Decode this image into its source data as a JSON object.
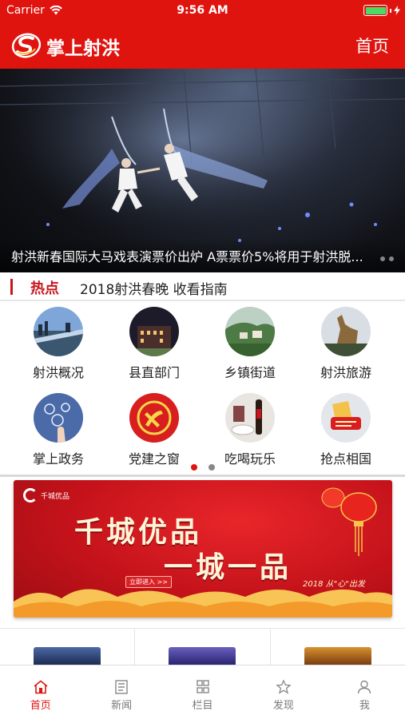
{
  "status_bar": {
    "carrier": "Carrier",
    "time": "9:56 AM",
    "battery_level": 1.0
  },
  "header": {
    "title": "掌上射洪",
    "home_link": "首页"
  },
  "banner": {
    "caption": "射洪新春国际大马戏表演票价出炉   A票票价5%将用于射洪脱...",
    "slide_count": 2
  },
  "hot": {
    "label": "热点",
    "headline": "2018射洪春晚  收看指南"
  },
  "grid": {
    "items": [
      {
        "label": "射洪概况",
        "icon": "city-skyline-icon"
      },
      {
        "label": "县直部门",
        "icon": "government-building-icon"
      },
      {
        "label": "乡镇街道",
        "icon": "town-landscape-icon"
      },
      {
        "label": "射洪旅游",
        "icon": "dinosaur-statue-icon"
      },
      {
        "label": "掌上政务",
        "icon": "touchscreen-icon"
      },
      {
        "label": "党建之窗",
        "icon": "party-emblem-icon"
      },
      {
        "label": "吃喝玩乐",
        "icon": "dining-icon"
      },
      {
        "label": "抢点相国",
        "icon": "promo-sticker-icon"
      }
    ],
    "page_count": 2,
    "active_page": 1
  },
  "promo": {
    "brand": "千城优品",
    "title_line1": "千城优品",
    "title_line2": "一城一品",
    "enter_label": "立即进入 >>",
    "year_text": "2018 从\"心\"出发"
  },
  "tabbar": {
    "items": [
      {
        "label": "首页",
        "icon": "home-icon",
        "active": true
      },
      {
        "label": "新闻",
        "icon": "news-icon",
        "active": false
      },
      {
        "label": "栏目",
        "icon": "grid-icon",
        "active": false
      },
      {
        "label": "发现",
        "icon": "discover-star-icon",
        "active": false
      },
      {
        "label": "我",
        "icon": "user-icon",
        "active": false
      }
    ]
  },
  "colors": {
    "brand_red": "#e0140f",
    "accent_red": "#c8161d",
    "battery_green": "#4cd964"
  }
}
